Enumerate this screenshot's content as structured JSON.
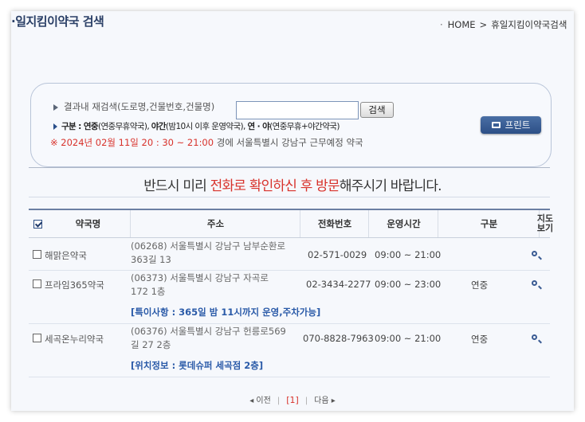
{
  "header": {
    "title": "·일지킴이약국 검색",
    "breadcrumb_home": "HOME",
    "breadcrumb_sep": ">",
    "breadcrumb_current": "휴일지킴이약국검색"
  },
  "search": {
    "label": "결과내 재검색(도로명,건물번호,건물명)",
    "input_value": "",
    "button_label": "검색",
    "legend_prefix": "구분 : ",
    "legend_yeonjung": "연중",
    "legend_yeonjung_desc": "(연중무휴약국), ",
    "legend_yagan": "야간",
    "legend_yagan_desc": "(밤10시 이후 운영약국), ",
    "legend_both": "연 · 야",
    "legend_both_desc": "(연중무휴+야간약국)",
    "date_text": "※ 2024년 02월 11일 20 : 30 ~ 21:00",
    "date_suffix": "경에  서울특별시  강남구   근무예정 약국",
    "print_label": "프린트"
  },
  "notice": {
    "pre": "반드시 미리 ",
    "highlight": "전화로 확인하신 후 방문",
    "post": "해주시기 바랍니다."
  },
  "table": {
    "headers": [
      "약국명",
      "주소",
      "전화번호",
      "운영시간",
      "구분",
      "지도\n보기"
    ],
    "rows": [
      {
        "name": "해맑은약국",
        "addr1": "(06268) 서울특별시 강남구 남부순환로",
        "addr2": "363길 13",
        "phone": "02-571-0029",
        "hours": "09:00 ~ 21:00",
        "type": "",
        "note": ""
      },
      {
        "name": "프라임365약국",
        "addr1": "(06373) 서울특별시 강남구 자곡로",
        "addr2": "172 1층",
        "phone": "02-3434-2277",
        "hours": "09:00 ~ 23:00",
        "type": "연중",
        "note": "[특이사항 : 365일 밤 11시까지 운영,주차가능]"
      },
      {
        "name": "세곡온누리약국",
        "addr1": "(06376) 서울특별시 강남구 헌릉로569",
        "addr2": "길 27 2층",
        "phone": "070-8828-7963",
        "hours": "09:00 ~ 21:00",
        "type": "연중",
        "note": "[위치정보 : 롯데슈퍼 세곡점 2층]"
      }
    ]
  },
  "pager": {
    "prev": "◂ 이전",
    "current": "[1]",
    "next": "다음 ▸"
  }
}
